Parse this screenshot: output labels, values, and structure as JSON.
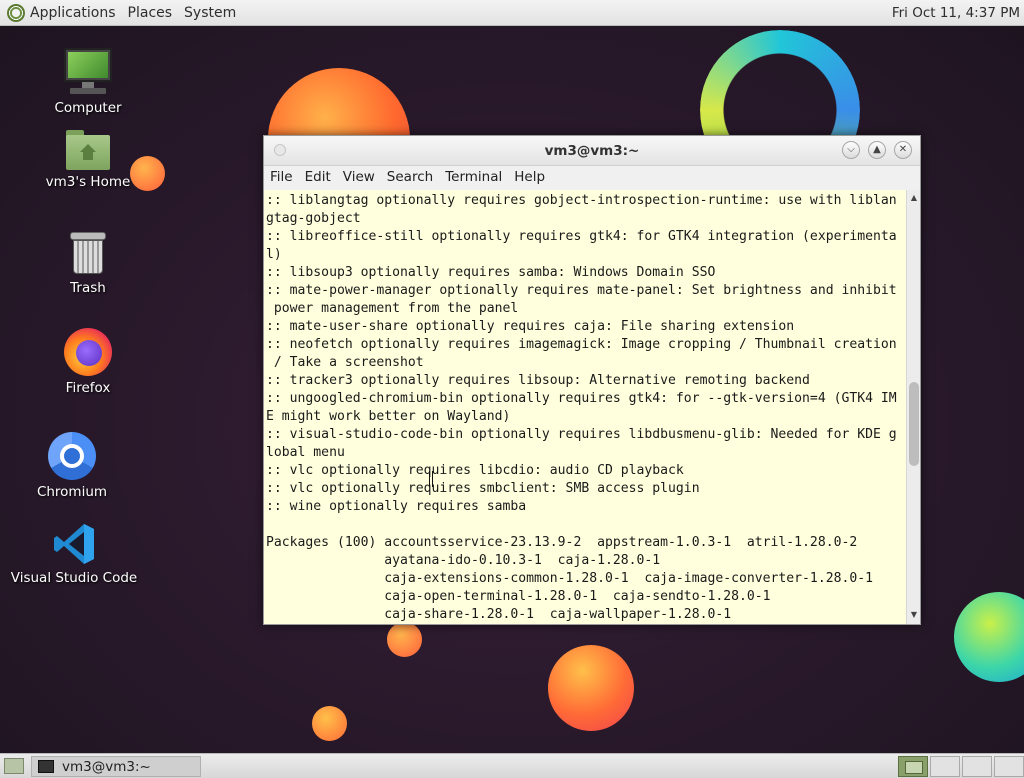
{
  "top_panel": {
    "menus": [
      "Applications",
      "Places",
      "System"
    ],
    "clock": "Fri Oct 11,  4:37 PM"
  },
  "desktop_icons": [
    {
      "label": "Computer",
      "icon": "computer-icon"
    },
    {
      "label": "vm3's Home",
      "icon": "home-folder-icon"
    },
    {
      "label": "Trash",
      "icon": "trash-icon"
    },
    {
      "label": "Firefox",
      "icon": "firefox-icon"
    },
    {
      "label": "Chromium",
      "icon": "chromium-icon"
    },
    {
      "label": "Visual Studio Code",
      "icon": "vscode-icon"
    }
  ],
  "terminal": {
    "title": "vm3@vm3:~",
    "menus": [
      "File",
      "Edit",
      "View",
      "Search",
      "Terminal",
      "Help"
    ],
    "lines": [
      ":: liblangtag optionally requires gobject-introspection-runtime: use with liblan",
      "gtag-gobject",
      ":: libreoffice-still optionally requires gtk4: for GTK4 integration (experimenta",
      "l)",
      ":: libsoup3 optionally requires samba: Windows Domain SSO",
      ":: mate-power-manager optionally requires mate-panel: Set brightness and inhibit",
      " power management from the panel",
      ":: mate-user-share optionally requires caja: File sharing extension",
      ":: neofetch optionally requires imagemagick: Image cropping / Thumbnail creation",
      " / Take a screenshot",
      ":: tracker3 optionally requires libsoup: Alternative remoting backend",
      ":: ungoogled-chromium-bin optionally requires gtk4: for --gtk-version=4 (GTK4 IM",
      "E might work better on Wayland)",
      ":: visual-studio-code-bin optionally requires libdbusmenu-glib: Needed for KDE g",
      "lobal menu",
      ":: vlc optionally requires libcdio: audio CD playback",
      ":: vlc optionally requires smbclient: SMB access plugin",
      ":: wine optionally requires samba",
      "",
      "Packages (100) accountsservice-23.13.9-2  appstream-1.0.3-1  atril-1.28.0-2",
      "               ayatana-ido-0.10.3-1  caja-1.28.0-1",
      "               caja-extensions-common-1.28.0-1  caja-image-converter-1.28.0-1",
      "               caja-open-terminal-1.28.0-1  caja-sendto-1.28.0-1",
      "               caja-share-1.28.0-1  caja-wallpaper-1.28.0-1"
    ]
  },
  "bottom_panel": {
    "task_label": "vm3@vm3:~"
  }
}
